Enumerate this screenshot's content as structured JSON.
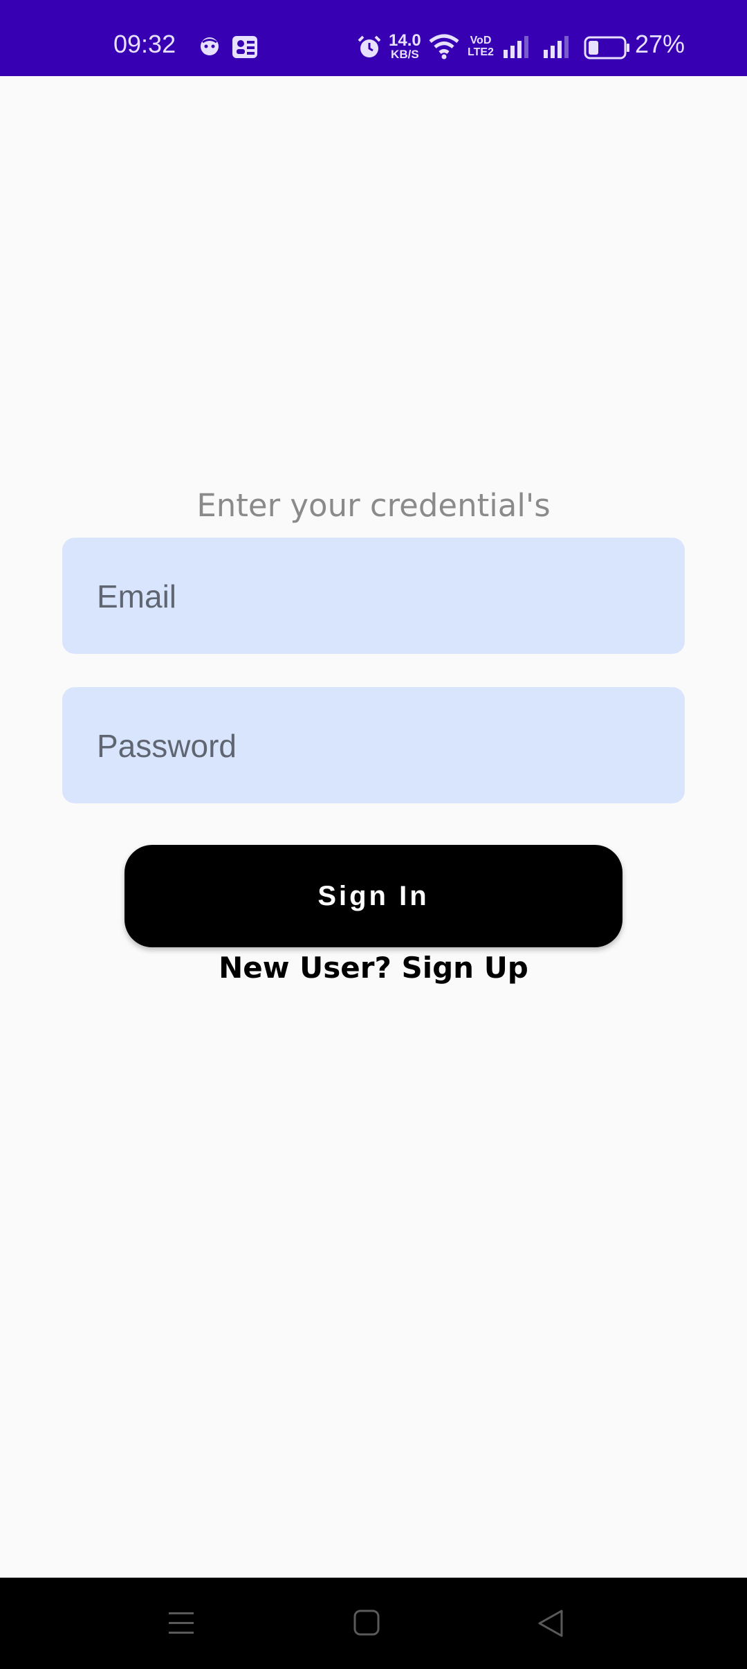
{
  "status_bar": {
    "time": "09:32",
    "speed_value": "14.0",
    "speed_unit": "KB/S",
    "network_label_1": "VoD",
    "network_label_2": "LTE2",
    "battery_percent": "27%",
    "background_color": "#3700b3",
    "icons": [
      "notification-face-icon",
      "notification-app-icon",
      "alarm-icon",
      "wifi-icon",
      "signal-1-icon",
      "signal-2-icon",
      "battery-icon"
    ]
  },
  "login": {
    "prompt": "Enter your credential's",
    "email_placeholder": "Email",
    "password_placeholder": "Password",
    "signin_label": "Sign In",
    "signup_link": "New User? Sign Up",
    "field_color": "#d8e5fd",
    "button_color": "#000000"
  },
  "nav_bar": {
    "icons": [
      "menu-icon",
      "home-icon",
      "back-icon"
    ]
  }
}
